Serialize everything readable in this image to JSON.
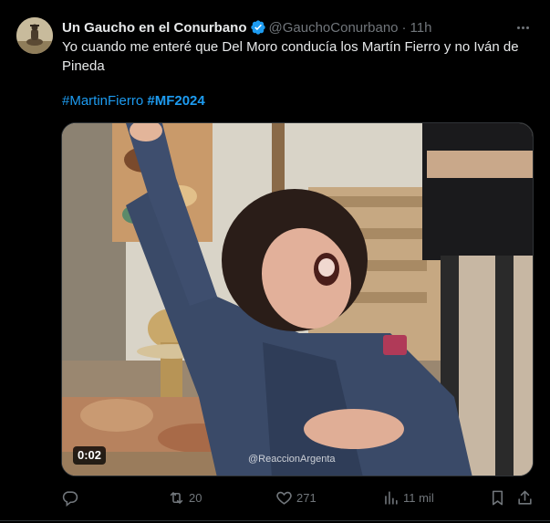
{
  "author": {
    "name": "Un Gaucho en el Conurbano",
    "handle": "@GauchoConurbano",
    "separator": "·",
    "time": "11h"
  },
  "tweet": {
    "text": "Yo cuando me enteré que Del Moro conducía los Martín Fierro y no Iván de Pineda",
    "hashtags": [
      "#MartinFierro",
      "#MF2024"
    ]
  },
  "media": {
    "duration": "0:02",
    "watermark": "@ReaccionArgenta"
  },
  "actions": {
    "retweets": "20",
    "likes": "271",
    "views": "11 mil"
  },
  "colors": {
    "accent": "#1d9bf0",
    "muted": "#71767b",
    "text": "#e7e9ea",
    "background": "#000000"
  },
  "icons": {
    "verified": "verified-badge-icon",
    "more": "more-options-icon",
    "reply": "reply-icon",
    "retweet": "retweet-icon",
    "like": "heart-icon",
    "views": "views-chart-icon",
    "bookmark": "bookmark-icon",
    "share": "share-icon"
  }
}
